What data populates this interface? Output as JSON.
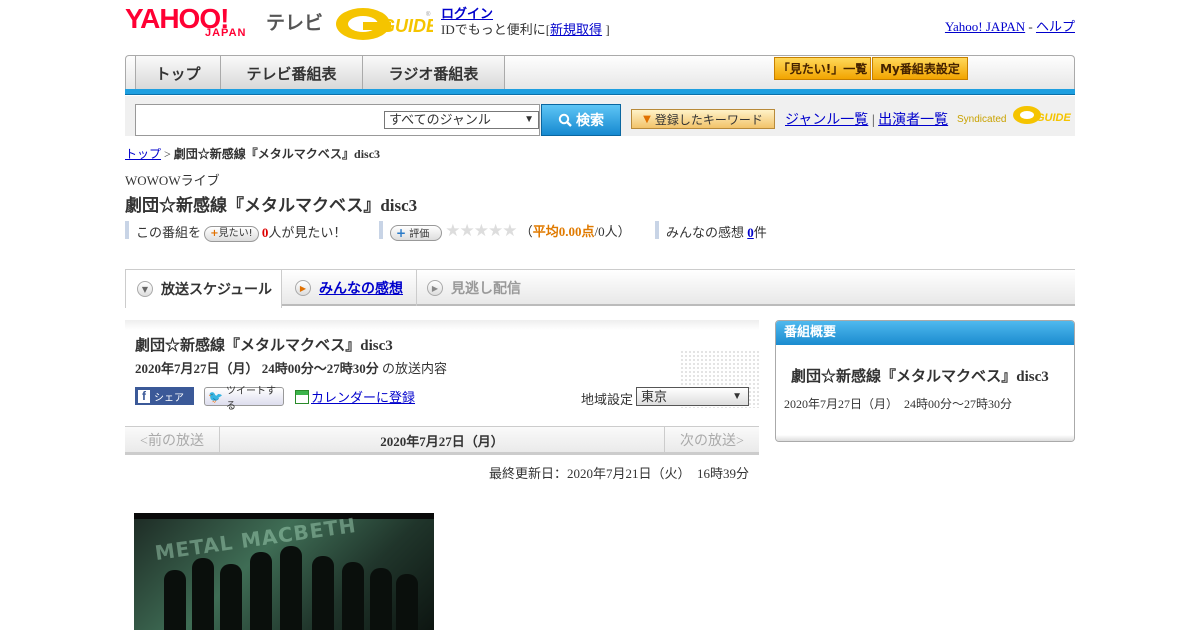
{
  "header": {
    "logo_yahoo": "YAHOO!",
    "logo_japan": "JAPAN",
    "logo_tv": "テレビ",
    "logo_gguide": "G-GUIDE",
    "login": "ログイン",
    "login_desc_prefix": "IDでもっと便利に[",
    "signup": "新規取得",
    "login_desc_suffix": "]",
    "yahoo_japan": "Yahoo! JAPAN",
    "link_sep": " - ",
    "help": "ヘルプ"
  },
  "nav": {
    "tabs": [
      "トップ",
      "テレビ番組表",
      "ラジオ番組表"
    ],
    "mitai_list": "「見たい!」一覧",
    "my_guide": "My番組表設定",
    "accent_color": "#1e9fe0"
  },
  "search": {
    "placeholder": "",
    "genre": "すべてのジャンル",
    "button": "検索",
    "keyword_button": "登録したキーワード",
    "genre_list": "ジャンル一覧",
    "sep": "|",
    "cast_list": "出演者一覧",
    "syndicated": "Syndicated"
  },
  "breadcrumb": {
    "home": "トップ",
    "sep": ">",
    "current": "劇団☆新感線『メタルマクベス』disc3"
  },
  "program": {
    "channel": "WOWOWライブ",
    "title": "劇団☆新感線『メタルマクベス』disc3",
    "mitai_prefix": "この番組を",
    "mitai_button": "見たい!",
    "mitai_count": "0",
    "mitai_suffix": "人が見たい！",
    "rate_button": "評価",
    "stars": "★★★★★",
    "avg_open": "（",
    "avg_label": "平均0.00点",
    "avg_count": "/0人）",
    "impressions_label": "みんなの感想",
    "impressions_count": "0",
    "impressions_unit": "件"
  },
  "tabs": {
    "schedule": "放送スケジュール",
    "impressions": "みんなの感想",
    "vod": "見逃し配信"
  },
  "broadcast": {
    "title": "劇団☆新感線『メタルマクベス』disc3",
    "date": "2020年7月27日（月）",
    "time": "24時00分～27時30分",
    "suffix": "の放送内容",
    "share": "シェア",
    "tweet": "ツイートする",
    "calendar": "カレンダーに登録",
    "region_label": "地域設定",
    "region_value": "東京",
    "prev": "<前の放送",
    "current_date": "2020年7月27日（月）",
    "next": "次の放送>",
    "updated": "最終更新日：2020年7月21日（火）　16時39分",
    "photo_text": "METAL MACBETH"
  },
  "summary": {
    "heading": "番組概要",
    "title": "劇団☆新感線『メタルマクベス』disc3",
    "datetime": "2020年7月27日（月）　24時00分～27時30分"
  }
}
